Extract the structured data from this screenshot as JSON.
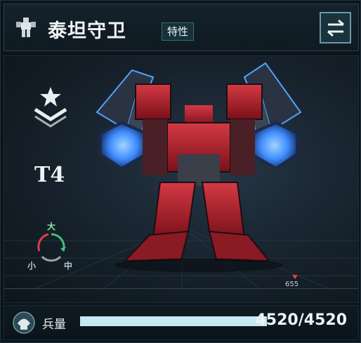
{
  "header": {
    "unit_name": "泰坦守卫",
    "trait_label": "特性",
    "unit_icon": "mech-unit-icon",
    "swap_icon": "swap-arrows-icon"
  },
  "rank": {
    "tier": "T4",
    "emblem_icon": "star-chevron-rank-icon"
  },
  "size_wheel": {
    "large": "大",
    "small": "小",
    "medium": "中",
    "icon": "size-cycle-icon"
  },
  "ruler": {
    "marker_value": "655"
  },
  "troops": {
    "label": "兵量",
    "value": "4520/4520",
    "current": 4520,
    "max": 4520,
    "icon": "soldier-helmet-icon"
  },
  "colors": {
    "accent": "#6a9aa8",
    "bar_fill": "#c6e9f4",
    "mech_red": "#b0222c",
    "mech_glow": "#3f8cff"
  }
}
